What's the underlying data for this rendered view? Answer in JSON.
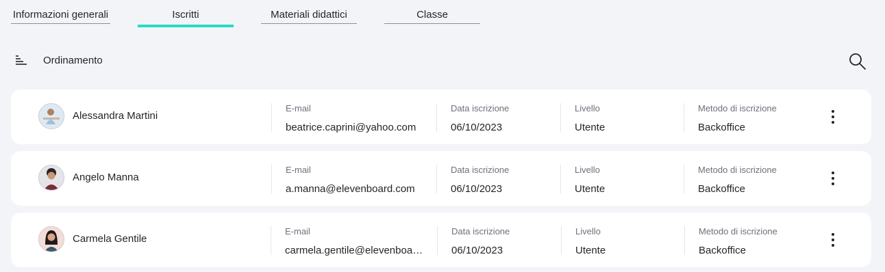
{
  "tabs": [
    {
      "label": "Informazioni generali",
      "active": false
    },
    {
      "label": "Iscritti",
      "active": true
    },
    {
      "label": "Materiali didattici",
      "active": false
    },
    {
      "label": "Classe",
      "active": false
    }
  ],
  "toolbar": {
    "sort_label": "Ordinamento",
    "sort_icon": "sort-lines-icon",
    "search_icon": "search-icon"
  },
  "columns": {
    "email": "E-mail",
    "date": "Data iscrizione",
    "level": "Livello",
    "method": "Metodo di iscrizione"
  },
  "enrollees": [
    {
      "name": "Alessandra Martini",
      "email": "beatrice.caprini@yahoo.com",
      "date": "06/10/2023",
      "level": "Utente",
      "method": "Backoffice",
      "avatar_bg": "#dfe9f2"
    },
    {
      "name": "Angelo Manna",
      "email": "a.manna@elevenboard.com",
      "date": "06/10/2023",
      "level": "Utente",
      "method": "Backoffice",
      "avatar_bg": "#e6e4e8"
    },
    {
      "name": "Carmela Gentile",
      "email": "carmela.gentile@elevenboard.com",
      "date": "06/10/2023",
      "level": "Utente",
      "method": "Backoffice",
      "avatar_bg": "#f6dcd6"
    }
  ],
  "colors": {
    "accent": "#29d9c6",
    "background": "#f3f4f8",
    "card": "#ffffff"
  }
}
